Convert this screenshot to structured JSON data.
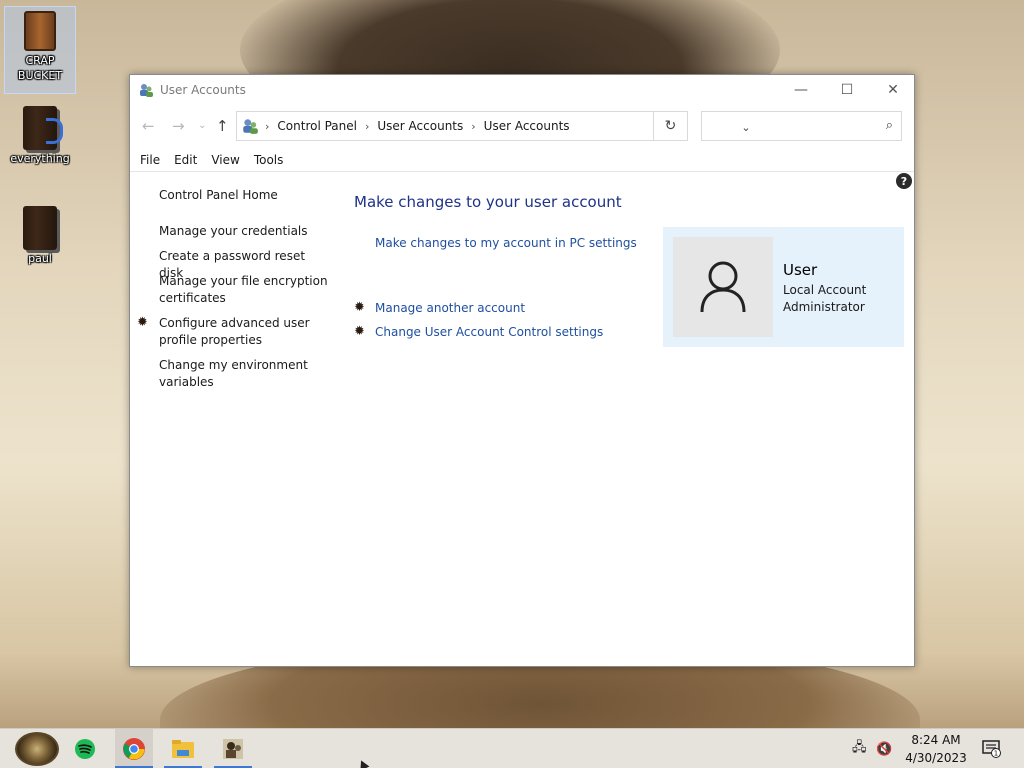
{
  "desktop": {
    "icons": [
      {
        "label": "CRAP BUCKET",
        "selected": true,
        "icon": "bucket-icon"
      },
      {
        "label": "everything",
        "selected": false,
        "icon": "book-headphones-icon"
      },
      {
        "label": "paul",
        "selected": false,
        "icon": "book-icon"
      }
    ]
  },
  "window": {
    "title": "User Accounts",
    "controls": {
      "minimize": "—",
      "maximize": "☐",
      "close": "✕"
    },
    "breadcrumb": [
      "Control Panel",
      "User Accounts",
      "User Accounts"
    ],
    "search_placeholder": "",
    "menu": [
      "File",
      "Edit",
      "View",
      "Tools"
    ],
    "help_label": "?",
    "left_pane": {
      "home": "Control Panel Home",
      "links": [
        "Manage your credentials",
        "Create a password reset disk",
        "Manage your file encryption certificates",
        "Configure advanced user profile properties",
        "Change my environment variables"
      ]
    },
    "main": {
      "heading": "Make changes to your user account",
      "pc_settings_link": "Make changes to my account in PC settings",
      "tasks": [
        "Manage another account",
        "Change User Account Control settings"
      ]
    },
    "account": {
      "name": "User",
      "type": "Local Account",
      "role": "Administrator"
    }
  },
  "taskbar": {
    "time": "8:24 AM",
    "date": "4/30/2023",
    "notification_count": "1",
    "accent_color": "#3b78d8"
  }
}
